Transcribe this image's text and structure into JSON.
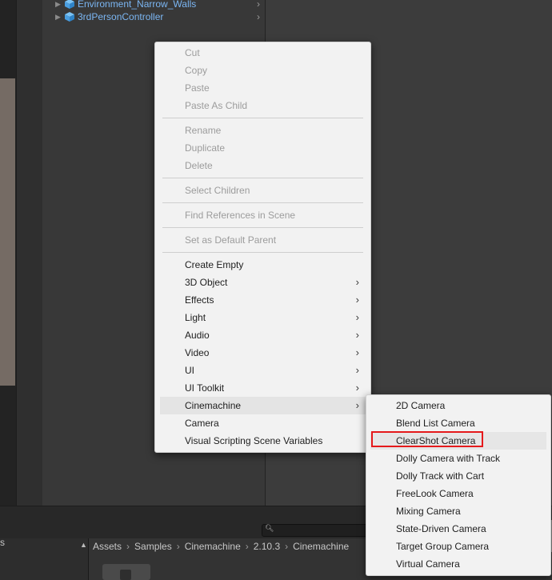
{
  "hierarchy": {
    "items": [
      {
        "label": "Environment_Narrow_Walls"
      },
      {
        "label": "3rdPersonController"
      }
    ]
  },
  "context_menu": {
    "group1": [
      "Cut",
      "Copy",
      "Paste",
      "Paste As Child"
    ],
    "group2": [
      "Rename",
      "Duplicate",
      "Delete"
    ],
    "group3": [
      "Select Children"
    ],
    "group4": [
      "Find References in Scene"
    ],
    "group5": [
      "Set as Default Parent"
    ],
    "group6": [
      "Create Empty",
      "3D Object",
      "Effects",
      "Light",
      "Audio",
      "Video",
      "UI",
      "UI Toolkit",
      "Cinemachine",
      "Camera",
      "Visual Scripting Scene Variables"
    ]
  },
  "submenu": {
    "items": [
      "2D Camera",
      "Blend List Camera",
      "ClearShot Camera",
      "Dolly Camera with Track",
      "Dolly Track with Cart",
      "FreeLook Camera",
      "Mixing Camera",
      "State-Driven Camera",
      "Target Group Camera",
      "Virtual Camera"
    ],
    "highlighted": "ClearShot Camera",
    "annotation_color": "#e5191b"
  },
  "project": {
    "left_text": "s",
    "breadcrumb": [
      "Assets",
      "Samples",
      "Cinemachine",
      "2.10.3",
      "Cinemachine"
    ]
  },
  "icons": {
    "hierarchy_object": "cube-icon",
    "expand": "triangle-right-icon",
    "submenu": "chevron-right-icon",
    "search": "search-icon"
  },
  "colors": {
    "hierarchy_text": "#7bb6f3",
    "menu_bg": "#f2f2f2",
    "disabled_text": "#9c9c9c"
  }
}
